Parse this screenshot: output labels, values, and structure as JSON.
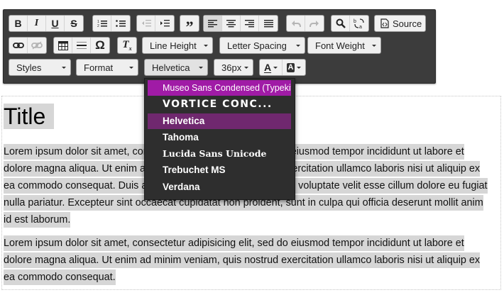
{
  "toolbar": {
    "row1": {
      "bold": "B",
      "italic": "I",
      "underline": "U",
      "strike": "S",
      "source_label": "Source"
    },
    "row2": {
      "line_height": "Line Height",
      "letter_spacing": "Letter Spacing",
      "font_weight": "Font Weight"
    },
    "row3": {
      "styles": "Styles",
      "format": "Format",
      "font": "Helvetica",
      "size": "36px",
      "text_color_glyph": "A",
      "bg_color_glyph": "A"
    }
  },
  "font_menu": {
    "items": [
      "Museo Sans Condensed (Typekit)",
      "VORTICE CONC...",
      "Helvetica",
      "Tahoma",
      "Lucida Sans Unicode",
      "Trebuchet MS",
      "Verdana"
    ],
    "hover_index": 0,
    "selected_index": 2,
    "hover_color": "#a01ba6",
    "selected_color": "#70286f"
  },
  "content": {
    "title": "Title",
    "paragraph1": "Lorem ipsum dolor sit amet, consectetur adipisicing elit, sed do eiusmod tempor incididunt ut labore et dolore magna aliqua. Ut enim ad minim veniam, quis nostrud exercitation ullamco laboris nisi ut aliquip ex ea commodo consequat. Duis aute irure dolor in reprehenderit in voluptate velit esse cillum dolore eu fugiat nulla pariatur. Excepteur sint occaecat cupidatat non proident, sunt in culpa qui officia deserunt mollit anim id est laborum.",
    "paragraph2": "Lorem ipsum dolor sit amet, consectetur adipisicing elit, sed do eiusmod tempor incididunt ut labore et dolore magna aliqua. Ut enim ad minim veniam, quis nostrud exercitation ullamco laboris nisi ut aliquip ex ea commodo consequat."
  },
  "colors": {
    "toolbar_bg": "#3c3c3c",
    "highlight": "#d6d6d6",
    "menu_bg": "#2e2e2e"
  }
}
